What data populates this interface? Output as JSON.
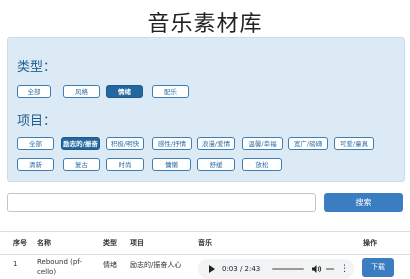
{
  "page": {
    "title": "音乐素材库"
  },
  "filters": {
    "type_label": "类型：",
    "type_chips": [
      {
        "label": "全部",
        "active": false
      },
      {
        "label": "风格",
        "active": false
      },
      {
        "label": "情绪",
        "active": true
      },
      {
        "label": "配乐",
        "active": false
      }
    ],
    "project_label": "项目：",
    "project_chips": [
      {
        "label": "全部",
        "active": false
      },
      {
        "label": "励志的/振奋",
        "active": true
      },
      {
        "label": "积极/明快",
        "active": false
      },
      {
        "label": "感性/抒情",
        "active": false
      },
      {
        "label": "浪漫/爱情",
        "active": false
      },
      {
        "label": "温馨/幸福",
        "active": false
      },
      {
        "label": "宽广/磅礴",
        "active": false
      },
      {
        "label": "可爱/童真",
        "active": false
      },
      {
        "label": "清新",
        "active": false
      },
      {
        "label": "复古",
        "active": false
      },
      {
        "label": "时尚",
        "active": false
      },
      {
        "label": "慵懒",
        "active": false
      },
      {
        "label": "舒缓",
        "active": false
      },
      {
        "label": "放松",
        "active": false
      }
    ]
  },
  "search": {
    "placeholder": "",
    "button_label": "搜索"
  },
  "table": {
    "headers": [
      "序号",
      "名称",
      "类型",
      "项目",
      "音乐",
      "操作"
    ],
    "rows": [
      {
        "index": "1",
        "name": "Rebound (pf-cello)",
        "type": "情绪",
        "project": "励志的/振奋人心",
        "time": "0:03 / 2:43",
        "progress": 0.02,
        "action": "下载"
      }
    ]
  },
  "colors": {
    "panel_bg": "#dceaf5",
    "accent": "#3b7dc1",
    "active_chip": "#24669f"
  }
}
